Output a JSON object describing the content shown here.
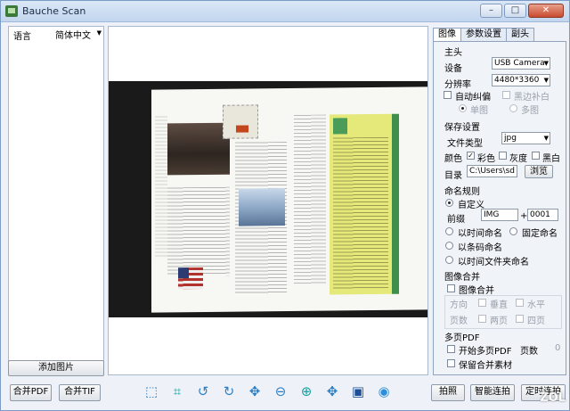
{
  "window": {
    "title": "Bauche Scan",
    "minimize": "–",
    "maximize": "□",
    "close": "✕"
  },
  "left": {
    "lang_label": "语言",
    "lang_value": "简体中文",
    "add_image": "添加图片",
    "merge_pdf": "合并PDF",
    "merge_tif": "合并TIF"
  },
  "tabs": [
    "图像",
    "参数设置",
    "副头"
  ],
  "camera": {
    "main_label": "主头",
    "device_label": "设备",
    "device_value": "USB Camera",
    "resolution_label": "分辨率",
    "resolution_value": "4480*3360",
    "deskew_label": "自动纠偏",
    "border_fill_label": "黑边补白",
    "single_label": "单图",
    "multi_label": "多图"
  },
  "save": {
    "section": "保存设置",
    "filetype_label": "文件类型",
    "filetype_value": "jpg",
    "color_label": "颜色",
    "color_opts": [
      "彩色",
      "灰度",
      "黑白"
    ],
    "dir_label": "目录",
    "dir_value": "C:\\Users\\sd",
    "browse": "浏览"
  },
  "naming": {
    "section": "命名规则",
    "custom": "自定义",
    "prefix_label": "前缀",
    "prefix_value": "IMG",
    "plus": "+",
    "number_value": "0001",
    "by_time": "以时间命名",
    "fixed": "固定命名",
    "by_barcode": "以条码命名",
    "by_folder": "以时间文件夹命名"
  },
  "merge": {
    "section": "图像合并",
    "merge_label": "图像合并",
    "direction": "方向",
    "vertical": "垂直",
    "horizontal": "水平",
    "pages": "页数",
    "two": "两页",
    "four": "四页"
  },
  "multipdf": {
    "section": "多页PDF",
    "start": "开始多页PDF",
    "pages_label": "页数",
    "pages_value": "0",
    "keep": "保留合并素材"
  },
  "actions": {
    "capture": "拍照",
    "smart": "智能连拍",
    "timer": "定时连拍"
  },
  "toolbar_icons": [
    "select-icon",
    "crop-icon",
    "rotate-left-icon",
    "rotate-right-icon",
    "fit-icon",
    "zoom-out-icon",
    "zoom-in-icon",
    "actual-size-icon",
    "film-icon",
    "record-icon"
  ],
  "watermark": "ZOL"
}
